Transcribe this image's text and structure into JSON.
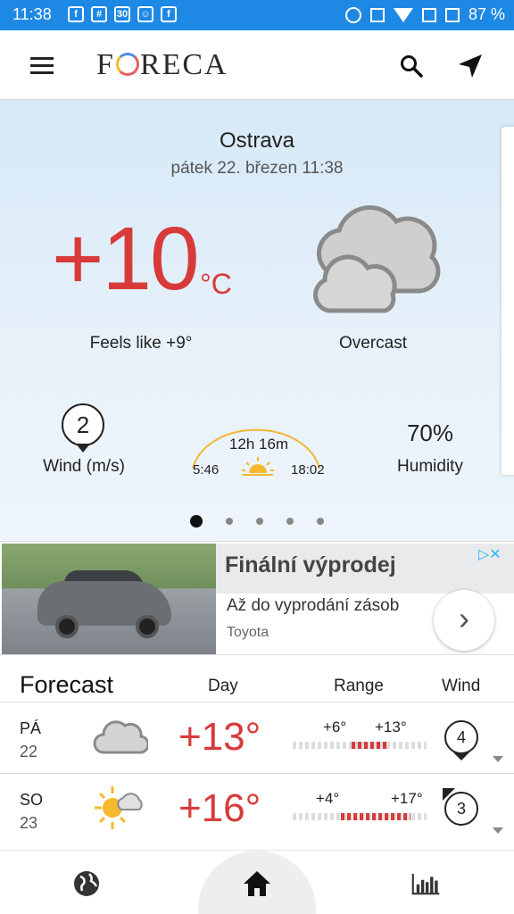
{
  "status_bar": {
    "time": "11:38",
    "battery": "87 %"
  },
  "app": {
    "logo": "FORECA"
  },
  "current": {
    "city": "Ostrava",
    "datetime": "pátek 22. březen 11:38",
    "temperature": "+10",
    "unit": "°C",
    "feels_like": "Feels like +9°",
    "condition": "Overcast",
    "wind_value": "2",
    "wind_label": "Wind (m/s)",
    "day_length": "12h 16m",
    "sunrise": "5:46",
    "sunset": "18:02",
    "humidity_value": "70%",
    "humidity_label": "Humidity",
    "page_dots": 5,
    "active_dot": 0
  },
  "ad": {
    "title": "Finální výprodej",
    "description": "Až do vyprodání zásob",
    "brand": "Toyota",
    "choices_icon": "▷✕"
  },
  "forecast": {
    "title": "Forecast",
    "col_day": "Day",
    "col_range": "Range",
    "col_wind": "Wind",
    "rows": [
      {
        "weekday": "PÁ",
        "date": "22",
        "icon": "cloud-icon",
        "temp": "+13°",
        "low": "+6°",
        "high": "+13°",
        "range_low": 6,
        "range_high": 13,
        "wind": "4"
      },
      {
        "weekday": "SO",
        "date": "23",
        "icon": "partly-sunny-icon",
        "temp": "+16°",
        "low": "+4°",
        "high": "+17°",
        "range_low": 4,
        "range_high": 17,
        "wind": "3"
      }
    ]
  },
  "colors": {
    "status_bar": "#1e88e5",
    "temperature": "#d83a3a",
    "sun": "#f5b82e"
  }
}
